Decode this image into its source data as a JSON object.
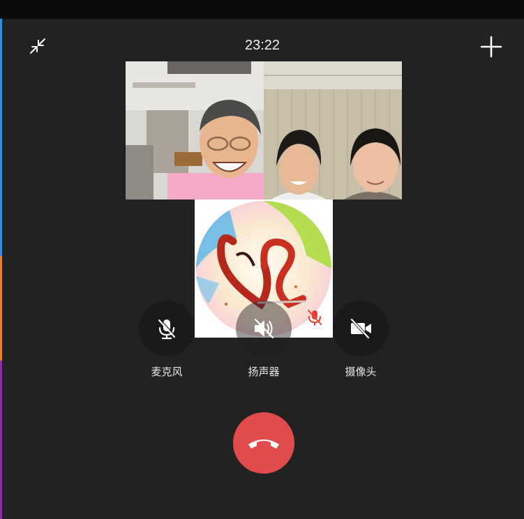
{
  "status_bar": {
    "time": "23:22"
  },
  "header": {
    "minimize_icon": "shrink-arrows-icon",
    "add_icon": "plus-icon"
  },
  "participants": [
    {
      "tile": "video",
      "camera": "on"
    },
    {
      "tile": "video",
      "camera": "on"
    },
    {
      "tile": "avatar",
      "microphone": "muted"
    }
  ],
  "controls": {
    "microphone": {
      "label": "麦克风",
      "icon": "mic-off-icon",
      "state": "off"
    },
    "speaker": {
      "label": "扬声器",
      "icon": "speaker-off-icon",
      "state": "off"
    },
    "camera": {
      "label": "摄像头",
      "icon": "camera-off-icon",
      "state": "off"
    }
  },
  "hangup": {
    "icon": "hang-up-phone-icon"
  },
  "colors": {
    "background": "#222222",
    "top_strip": "#0c0c0c",
    "control_circle": "#1a1a1a",
    "hangup_red": "#e14b4b",
    "muted_red": "#e8412f",
    "edge_blue": "#2f8ee6",
    "edge_orange": "#ef7a27",
    "edge_purple": "#8a2fb0"
  }
}
